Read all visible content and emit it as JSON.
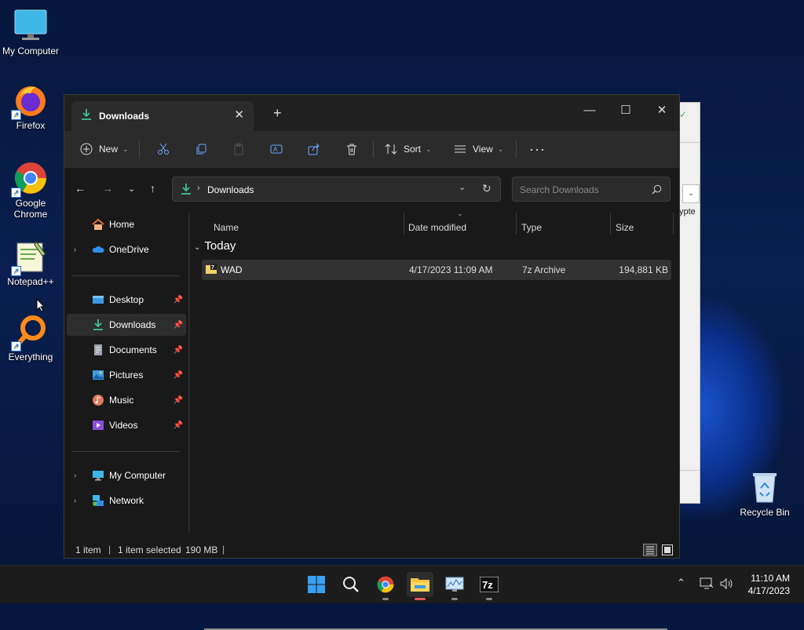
{
  "desktop": {
    "icons": [
      {
        "label": "My Computer"
      },
      {
        "label": "Firefox"
      },
      {
        "label": "Google Chrome"
      },
      {
        "label": "Notepad++"
      },
      {
        "label": "Everything"
      },
      {
        "label": "Recycle Bin"
      }
    ]
  },
  "background_window": {
    "fragment": "ypte"
  },
  "explorer": {
    "tab_title": "Downloads",
    "commands": {
      "new": "New",
      "sort": "Sort",
      "view": "View"
    },
    "address": {
      "path": "Downloads",
      "search_placeholder": "Search Downloads"
    },
    "sidebar": {
      "items": [
        {
          "label": "Home",
          "icon": "home-icon"
        },
        {
          "label": "OneDrive",
          "icon": "cloud-icon"
        },
        {
          "label": "Desktop",
          "icon": "desktop-folder-icon"
        },
        {
          "label": "Downloads",
          "icon": "download-icon"
        },
        {
          "label": "Documents",
          "icon": "documents-icon"
        },
        {
          "label": "Pictures",
          "icon": "pictures-icon"
        },
        {
          "label": "Music",
          "icon": "music-icon"
        },
        {
          "label": "Videos",
          "icon": "videos-icon"
        },
        {
          "label": "My Computer",
          "icon": "computer-icon"
        },
        {
          "label": "Network",
          "icon": "network-icon"
        }
      ]
    },
    "columns": [
      "Name",
      "Date modified",
      "Type",
      "Size"
    ],
    "group_label": "Today",
    "files": [
      {
        "name": "WAD",
        "date": "4/17/2023 11:09 AM",
        "type": "7z Archive",
        "size": "194,881 KB"
      }
    ],
    "status": {
      "count": "1 item",
      "selected": "1 item selected",
      "size": "190 MB"
    }
  },
  "taskbar": {
    "time": "11:10 AM",
    "date": "4/17/2023"
  }
}
